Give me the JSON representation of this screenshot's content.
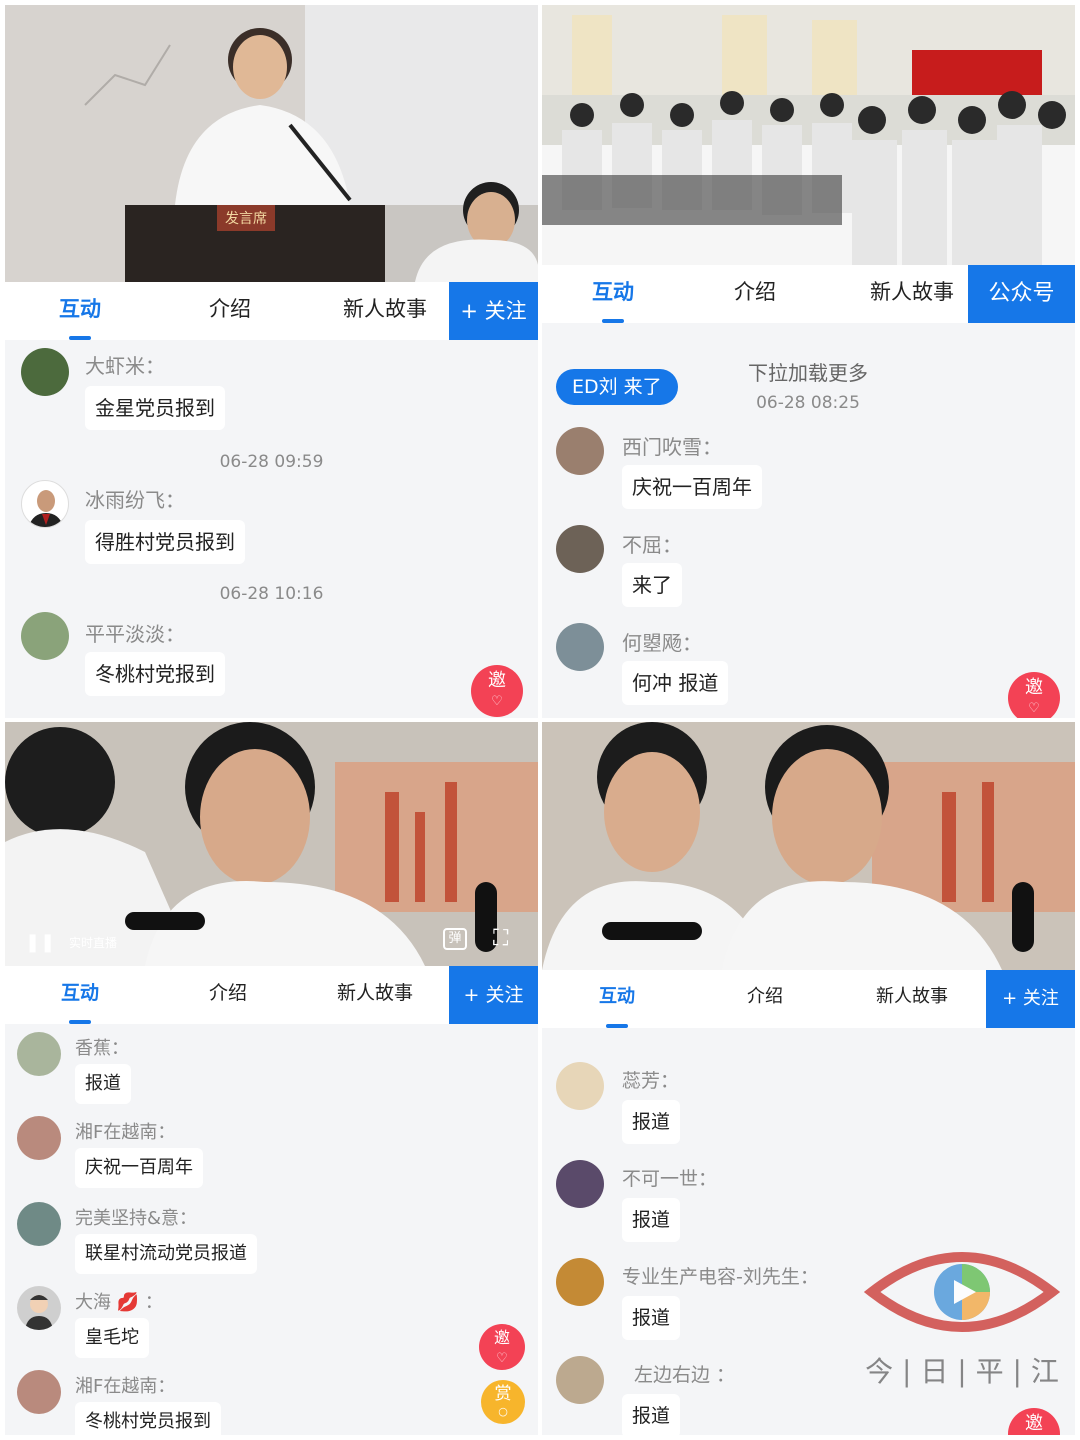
{
  "panels": [
    {
      "tabs": [
        "互动",
        "介绍",
        "新人故事"
      ],
      "cta": "+ 关注",
      "messages": [
        {
          "name": "大虾米：",
          "text": "金星党员报到"
        },
        {
          "timestamp": "06-28 09:59"
        },
        {
          "name": "冰雨纷飞：",
          "text": "得胜村党员报到"
        },
        {
          "timestamp": "06-28 10:16"
        },
        {
          "name": "平平淡淡：",
          "text": "冬桃村党报到"
        }
      ],
      "video_caption": "发言席",
      "invite": "邀"
    },
    {
      "tabs": [
        "互动",
        "介绍",
        "新人故事"
      ],
      "cta": "公众号",
      "join_notice": "ED刘 来了",
      "pull_hint": "下拉加载更多",
      "timestamp": "06-28 08:25",
      "messages": [
        {
          "name": "西门吹雪：",
          "text": "庆祝一百周年"
        },
        {
          "name": "不屈：",
          "text": "来了"
        },
        {
          "name": "何曌飏：",
          "text": "何冲 报道"
        }
      ],
      "invite": "邀"
    },
    {
      "tabs": [
        "互动",
        "介绍",
        "新人故事"
      ],
      "cta": "+ 关注",
      "live_label": "实时直播",
      "danmaku": "弹",
      "messages": [
        {
          "name": "香蕉：",
          "text": "报道"
        },
        {
          "name": "湘F在越南：",
          "text": "庆祝一百周年"
        },
        {
          "name": "完美坚持&意：",
          "text": "联星村流动党员报道"
        },
        {
          "name": "大海",
          "text": "皇毛坨"
        },
        {
          "name": "湘F在越南：",
          "text": "冬桃村党员报到"
        }
      ],
      "invite": "邀",
      "reward": "赏"
    },
    {
      "tabs": [
        "互动",
        "介绍",
        "新人故事"
      ],
      "cta": "+ 关注",
      "messages": [
        {
          "name": "蕊芳：",
          "text": "报道"
        },
        {
          "name": "不可一世：",
          "text": "报道"
        },
        {
          "name": "专业生产电容-刘先生：",
          "text": "报道"
        },
        {
          "name": "左边右边 ：",
          "text": "报道"
        }
      ],
      "watermark": "今 | 日 | 平 | 江",
      "invite": "邀"
    }
  ],
  "colors": {
    "accent": "#1677e8",
    "invite": "#f34255",
    "reward": "#f7b52c",
    "chat_bg": "#f4f5f7"
  }
}
